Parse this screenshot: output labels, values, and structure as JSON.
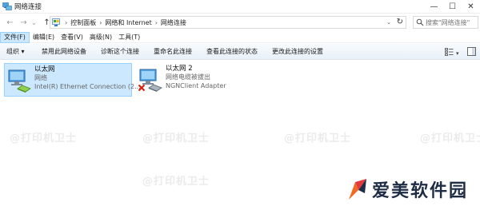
{
  "window": {
    "title": "网络连接"
  },
  "controls": {
    "minimize": "—",
    "maximize": "☐",
    "close": "✕"
  },
  "nav": {
    "back": "←",
    "forward": "→",
    "history": "⌄",
    "up": "↑"
  },
  "address": {
    "crumbs": [
      "控制面板",
      "网络和 Internet",
      "网络连接"
    ],
    "separator": "›",
    "leading_arrow": "›",
    "dropdown": "⌄",
    "refresh": "↻"
  },
  "search": {
    "placeholder": "搜索\"网络连接\""
  },
  "menu": [
    {
      "label": "文件(F)",
      "active": true
    },
    {
      "label": "编辑(E)"
    },
    {
      "label": "查看(V)"
    },
    {
      "label": "高级(N)"
    },
    {
      "label": "工具(T)"
    }
  ],
  "commands": {
    "organize": "组织 ▾",
    "disable": "禁用此网络设备",
    "diagnose": "诊断这个连接",
    "rename": "重命名此连接",
    "status": "查看此连接的状态",
    "settings": "更改此连接的设置",
    "view_arrow": "▾"
  },
  "connections": [
    {
      "name": "以太网",
      "status": "网络",
      "adapter": "Intel(R) Ethernet Connection (2...",
      "selected": true,
      "disconnected": false
    },
    {
      "name": "以太网 2",
      "status": "网络电缆被拔出",
      "adapter": "NGNClient Adapter",
      "selected": false,
      "disconnected": true
    }
  ],
  "watermark": {
    "text": "@打印机卫士"
  },
  "brand": {
    "name": "爱美软件园"
  },
  "colors": {
    "selection": "#cce8ff",
    "selection_border": "#99d1ff",
    "disconnect": "#d81e06",
    "brand_orange": "#f26a21",
    "brand_red": "#e4393c"
  }
}
